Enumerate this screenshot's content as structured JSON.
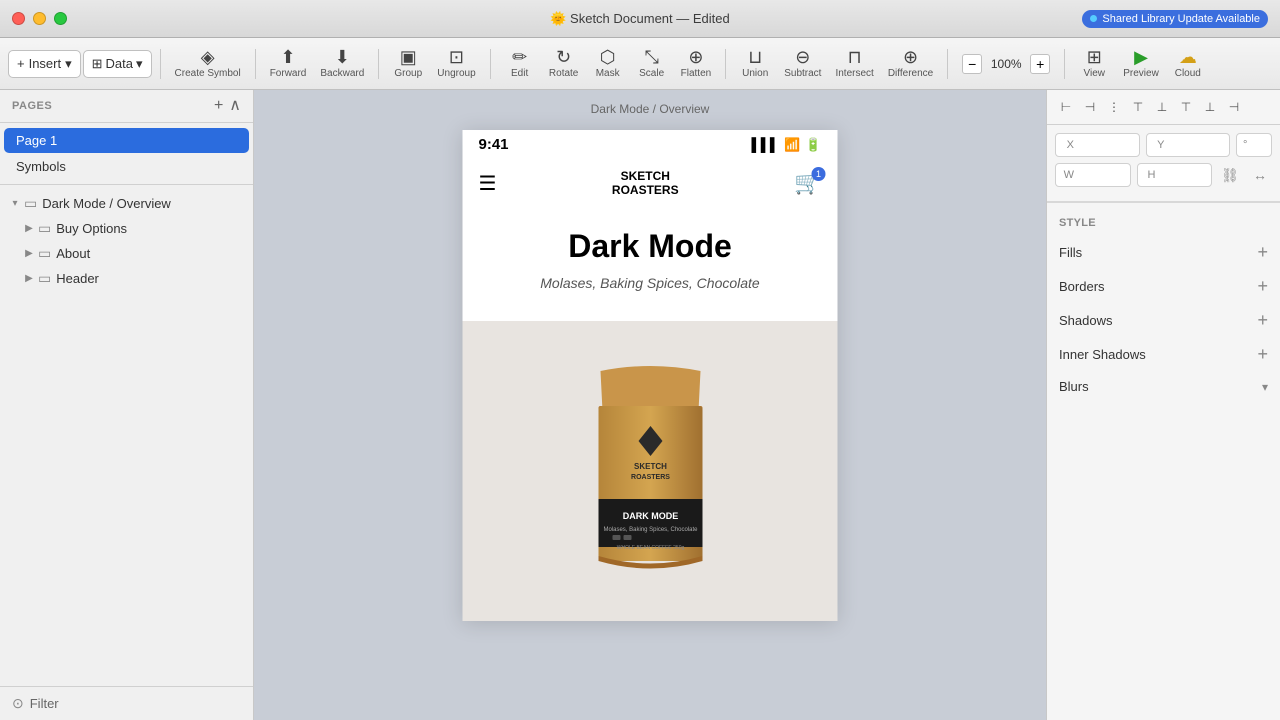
{
  "titlebar": {
    "title": "🌞 Sketch Document — Edited",
    "shared_library": "Shared Library Update Available"
  },
  "toolbar": {
    "insert_label": "Insert",
    "data_label": "Data",
    "create_symbol_label": "Create Symbol",
    "forward_label": "Forward",
    "backward_label": "Backward",
    "group_label": "Group",
    "ungroup_label": "Ungroup",
    "edit_label": "Edit",
    "rotate_label": "Rotate",
    "mask_label": "Mask",
    "scale_label": "Scale",
    "flatten_label": "Flatten",
    "union_label": "Union",
    "subtract_label": "Subtract",
    "intersect_label": "Intersect",
    "difference_label": "Difference",
    "zoom_value": "100%",
    "view_label": "View",
    "preview_label": "Preview",
    "cloud_label": "Cloud"
  },
  "sidebar": {
    "pages_title": "PAGES",
    "pages": [
      {
        "id": "page1",
        "label": "Page 1",
        "active": true
      },
      {
        "id": "symbols",
        "label": "Symbols",
        "active": false
      }
    ],
    "layers": [
      {
        "id": "dm-overview",
        "label": "Dark Mode / Overview",
        "indent": 0,
        "expanded": true,
        "has_children": true
      },
      {
        "id": "buy-options",
        "label": "Buy Options",
        "indent": 1,
        "has_children": true,
        "expanded": false
      },
      {
        "id": "about",
        "label": "About",
        "indent": 1,
        "has_children": true,
        "expanded": false
      },
      {
        "id": "header",
        "label": "Header",
        "indent": 1,
        "has_children": true,
        "expanded": false
      }
    ],
    "filter_label": "Filter"
  },
  "canvas": {
    "breadcrumb": "Dark Mode / Overview",
    "artboard": {
      "status_time": "9:41",
      "app_name_line1": "SKETCH",
      "app_name_line2": "ROASTERS",
      "cart_badge": "1",
      "product_title": "Dark Mode",
      "product_subtitle": "Molases, Baking Spices, Chocolate",
      "product_label": "DARK MODE",
      "product_description": "Molases, Baking Spices, Chocolate"
    }
  },
  "right_panel": {
    "style_title": "STYLE",
    "fills_label": "Fills",
    "borders_label": "Borders",
    "shadows_label": "Shadows",
    "inner_shadows_label": "Inner Shadows",
    "blurs_label": "Blurs"
  },
  "icons": {
    "hamburger": "☰",
    "cart": "🛒",
    "signal": "▌▌▌",
    "wifi": "◡",
    "battery": "▬",
    "chevron_down": "▾",
    "chevron_right": "▶",
    "plus": "+",
    "filter": "⊙",
    "minus": "−"
  }
}
